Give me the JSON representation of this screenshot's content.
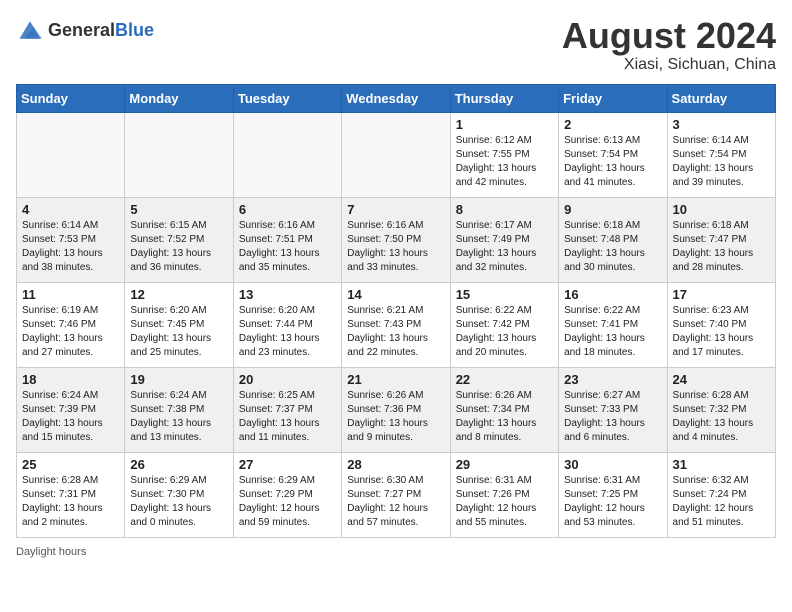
{
  "header": {
    "logo": {
      "general": "General",
      "blue": "Blue"
    },
    "title": "August 2024",
    "subtitle": "Xiasi, Sichuan, China"
  },
  "days_of_week": [
    "Sunday",
    "Monday",
    "Tuesday",
    "Wednesday",
    "Thursday",
    "Friday",
    "Saturday"
  ],
  "weeks": [
    [
      {
        "day": "",
        "info": ""
      },
      {
        "day": "",
        "info": ""
      },
      {
        "day": "",
        "info": ""
      },
      {
        "day": "",
        "info": ""
      },
      {
        "day": "1",
        "info": "Sunrise: 6:12 AM\nSunset: 7:55 PM\nDaylight: 13 hours\nand 42 minutes."
      },
      {
        "day": "2",
        "info": "Sunrise: 6:13 AM\nSunset: 7:54 PM\nDaylight: 13 hours\nand 41 minutes."
      },
      {
        "day": "3",
        "info": "Sunrise: 6:14 AM\nSunset: 7:54 PM\nDaylight: 13 hours\nand 39 minutes."
      }
    ],
    [
      {
        "day": "4",
        "info": "Sunrise: 6:14 AM\nSunset: 7:53 PM\nDaylight: 13 hours\nand 38 minutes."
      },
      {
        "day": "5",
        "info": "Sunrise: 6:15 AM\nSunset: 7:52 PM\nDaylight: 13 hours\nand 36 minutes."
      },
      {
        "day": "6",
        "info": "Sunrise: 6:16 AM\nSunset: 7:51 PM\nDaylight: 13 hours\nand 35 minutes."
      },
      {
        "day": "7",
        "info": "Sunrise: 6:16 AM\nSunset: 7:50 PM\nDaylight: 13 hours\nand 33 minutes."
      },
      {
        "day": "8",
        "info": "Sunrise: 6:17 AM\nSunset: 7:49 PM\nDaylight: 13 hours\nand 32 minutes."
      },
      {
        "day": "9",
        "info": "Sunrise: 6:18 AM\nSunset: 7:48 PM\nDaylight: 13 hours\nand 30 minutes."
      },
      {
        "day": "10",
        "info": "Sunrise: 6:18 AM\nSunset: 7:47 PM\nDaylight: 13 hours\nand 28 minutes."
      }
    ],
    [
      {
        "day": "11",
        "info": "Sunrise: 6:19 AM\nSunset: 7:46 PM\nDaylight: 13 hours\nand 27 minutes."
      },
      {
        "day": "12",
        "info": "Sunrise: 6:20 AM\nSunset: 7:45 PM\nDaylight: 13 hours\nand 25 minutes."
      },
      {
        "day": "13",
        "info": "Sunrise: 6:20 AM\nSunset: 7:44 PM\nDaylight: 13 hours\nand 23 minutes."
      },
      {
        "day": "14",
        "info": "Sunrise: 6:21 AM\nSunset: 7:43 PM\nDaylight: 13 hours\nand 22 minutes."
      },
      {
        "day": "15",
        "info": "Sunrise: 6:22 AM\nSunset: 7:42 PM\nDaylight: 13 hours\nand 20 minutes."
      },
      {
        "day": "16",
        "info": "Sunrise: 6:22 AM\nSunset: 7:41 PM\nDaylight: 13 hours\nand 18 minutes."
      },
      {
        "day": "17",
        "info": "Sunrise: 6:23 AM\nSunset: 7:40 PM\nDaylight: 13 hours\nand 17 minutes."
      }
    ],
    [
      {
        "day": "18",
        "info": "Sunrise: 6:24 AM\nSunset: 7:39 PM\nDaylight: 13 hours\nand 15 minutes."
      },
      {
        "day": "19",
        "info": "Sunrise: 6:24 AM\nSunset: 7:38 PM\nDaylight: 13 hours\nand 13 minutes."
      },
      {
        "day": "20",
        "info": "Sunrise: 6:25 AM\nSunset: 7:37 PM\nDaylight: 13 hours\nand 11 minutes."
      },
      {
        "day": "21",
        "info": "Sunrise: 6:26 AM\nSunset: 7:36 PM\nDaylight: 13 hours\nand 9 minutes."
      },
      {
        "day": "22",
        "info": "Sunrise: 6:26 AM\nSunset: 7:34 PM\nDaylight: 13 hours\nand 8 minutes."
      },
      {
        "day": "23",
        "info": "Sunrise: 6:27 AM\nSunset: 7:33 PM\nDaylight: 13 hours\nand 6 minutes."
      },
      {
        "day": "24",
        "info": "Sunrise: 6:28 AM\nSunset: 7:32 PM\nDaylight: 13 hours\nand 4 minutes."
      }
    ],
    [
      {
        "day": "25",
        "info": "Sunrise: 6:28 AM\nSunset: 7:31 PM\nDaylight: 13 hours\nand 2 minutes."
      },
      {
        "day": "26",
        "info": "Sunrise: 6:29 AM\nSunset: 7:30 PM\nDaylight: 13 hours\nand 0 minutes."
      },
      {
        "day": "27",
        "info": "Sunrise: 6:29 AM\nSunset: 7:29 PM\nDaylight: 12 hours\nand 59 minutes."
      },
      {
        "day": "28",
        "info": "Sunrise: 6:30 AM\nSunset: 7:27 PM\nDaylight: 12 hours\nand 57 minutes."
      },
      {
        "day": "29",
        "info": "Sunrise: 6:31 AM\nSunset: 7:26 PM\nDaylight: 12 hours\nand 55 minutes."
      },
      {
        "day": "30",
        "info": "Sunrise: 6:31 AM\nSunset: 7:25 PM\nDaylight: 12 hours\nand 53 minutes."
      },
      {
        "day": "31",
        "info": "Sunrise: 6:32 AM\nSunset: 7:24 PM\nDaylight: 12 hours\nand 51 minutes."
      }
    ]
  ],
  "footer": {
    "daylight_hours_label": "Daylight hours"
  }
}
